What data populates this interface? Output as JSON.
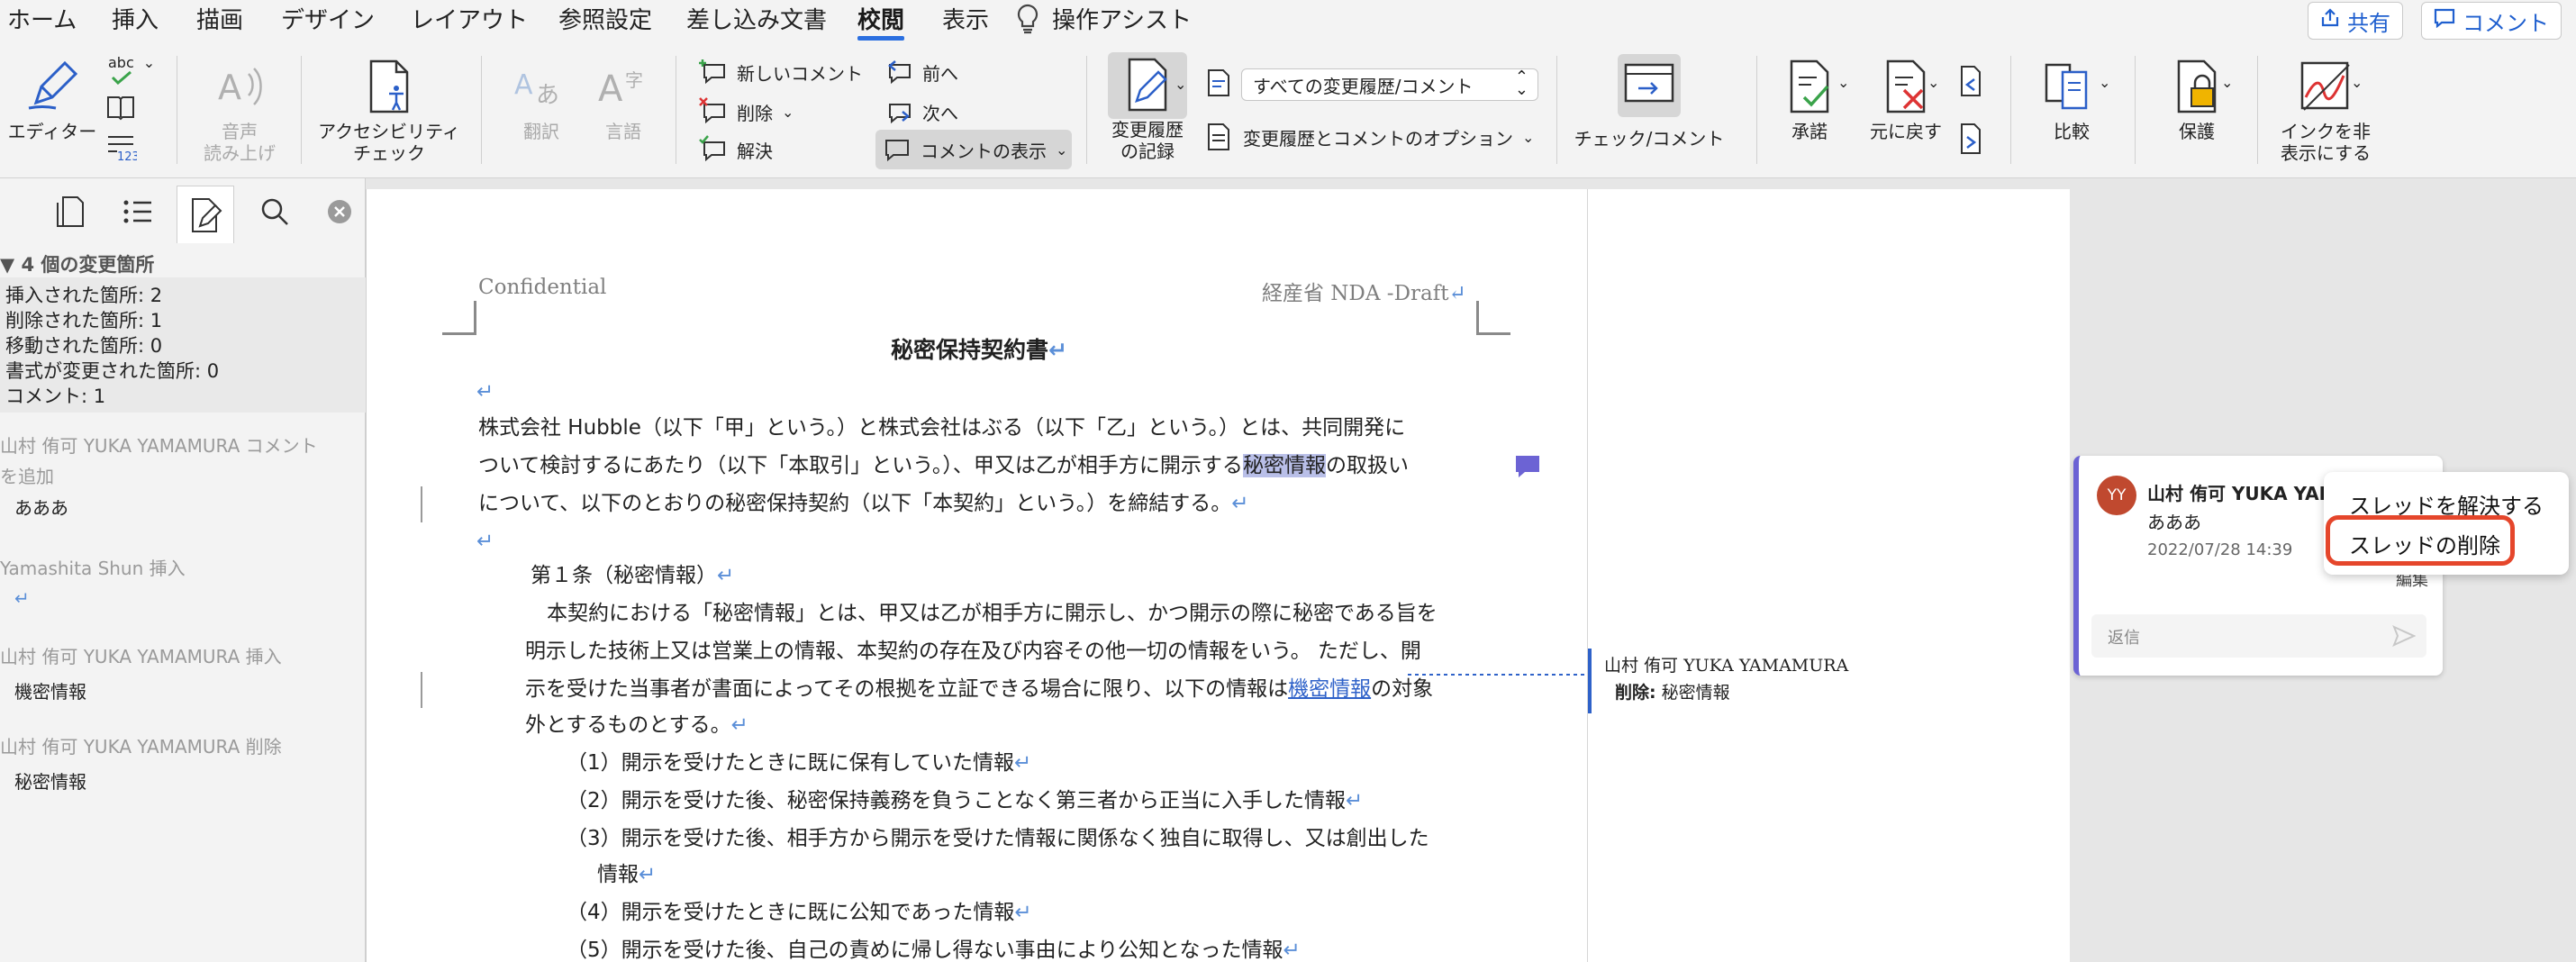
{
  "menubar": {
    "tabs": [
      "ホーム",
      "挿入",
      "描画",
      "デザイン",
      "レイアウト",
      "参照設定",
      "差し込み文書",
      "校閲",
      "表示",
      "操作アシスト"
    ],
    "active_tab": "校閲",
    "share_label": "共有",
    "comment_label": "コメント"
  },
  "ribbon": {
    "editor": "エディター",
    "spell_abc": "abc",
    "read_aloud": [
      "音声",
      "読み上げ"
    ],
    "accessibility": [
      "アクセシビリティ",
      "チェック"
    ],
    "translate": "翻訳",
    "language": "言語",
    "new_comment": "新しいコメント",
    "delete": "削除",
    "resolve": "解決",
    "prev": "前へ",
    "next": "次へ",
    "show_comments": "コメントの表示",
    "track_changes": [
      "変更履歴",
      "の記録"
    ],
    "markup_dropdown": "すべての変更履歴/コメント",
    "track_options": "変更履歴とコメントのオプション",
    "check_comment": "チェック/コメント",
    "accept": "承諾",
    "reject": "元に戻す",
    "compare": "比較",
    "protect": "保護",
    "hide_ink": [
      "インクを非",
      "表示にする"
    ]
  },
  "navpane": {
    "count_header": "▼ 4 個の変更箇所",
    "summary": [
      "挿入された箇所: 2",
      "削除された箇所: 1",
      "移動された箇所: 0",
      "書式が変更された箇所: 0",
      "コメント: 1"
    ],
    "changes": [
      {
        "title1": "山村 侑可 YUKA YAMAMURA コメント",
        "title2": "を追加",
        "body": "あああ"
      },
      {
        "title1": "Yamashita Shun 挿入",
        "body": ""
      },
      {
        "title1": "山村 侑可 YUKA YAMAMURA 挿入",
        "body": "機密情報"
      },
      {
        "title1": "山村 侑可 YUKA YAMAMURA 削除",
        "body": "秘密情報"
      }
    ]
  },
  "document": {
    "header_left": "Confidential",
    "header_right": "経産省 NDA -Draft",
    "title": "秘密保持契約書",
    "para1_line1": "株式会社 Hubble（以下「甲」という。）と株式会社はぶる（以下「乙」という。）とは、共同開発に",
    "para1_line2a": "ついて検討するにあたり（以下「本取引」という。）、甲又は乙が相手方に開示する",
    "para1_line2_hl": "秘密情報",
    "para1_line2b": "の取扱い",
    "para1_line3": "について、以下のとおりの秘密保持契約（以下「本契約」という。）を締結する。",
    "article1": "第１条（秘密情報）",
    "art_l1": "本契約における「秘密情報」とは、甲又は乙が相手方に開示し、かつ開示の際に秘密である旨を",
    "art_l2": "明示した技術上又は営業上の情報、本契約の存在及び内容その他一切の情報をいう。 ただし、開",
    "art_l3a": "示を受けた当事者が書面によってその根拠を立証できる場合に限り、以下の情報は",
    "art_l3_ins": "機密情報",
    "art_l3b": "の対象",
    "art_l4": "外とするものとする。",
    "items": [
      "（1）開示を受けたときに既に保有していた情報",
      "（2）開示を受けた後、秘密保持義務を負うことなく第三者から正当に入手した情報",
      "（3）開示を受けた後、相手方から開示を受けた情報に関係なく独自に取得し、又は創出した",
      "情報",
      "（4）開示を受けたときに既に公知であった情報",
      "（5）開示を受けた後、自己の責めに帰し得ない事由により公知となった情報"
    ],
    "pilcrow": "↵"
  },
  "markup": {
    "author": "山村 侑可 YUKA YAMAMURA",
    "deleted_label": "削除:",
    "deleted_text": "秘密情報"
  },
  "comment": {
    "initials": "YY",
    "author": "山村 侑可 YUKA YAM",
    "text": "あああ",
    "date": "2022/07/28 14:39",
    "edit": "編集",
    "more": "…",
    "reply_placeholder": "返信"
  },
  "context_menu": {
    "resolve_thread": "スレッドを解決する",
    "delete_thread": "スレッドの削除"
  },
  "colors": {
    "accent": "#2b6fe0",
    "comment_bar": "#6c63d4",
    "highlight": "#e5462b",
    "avatar": "#c0492f"
  }
}
